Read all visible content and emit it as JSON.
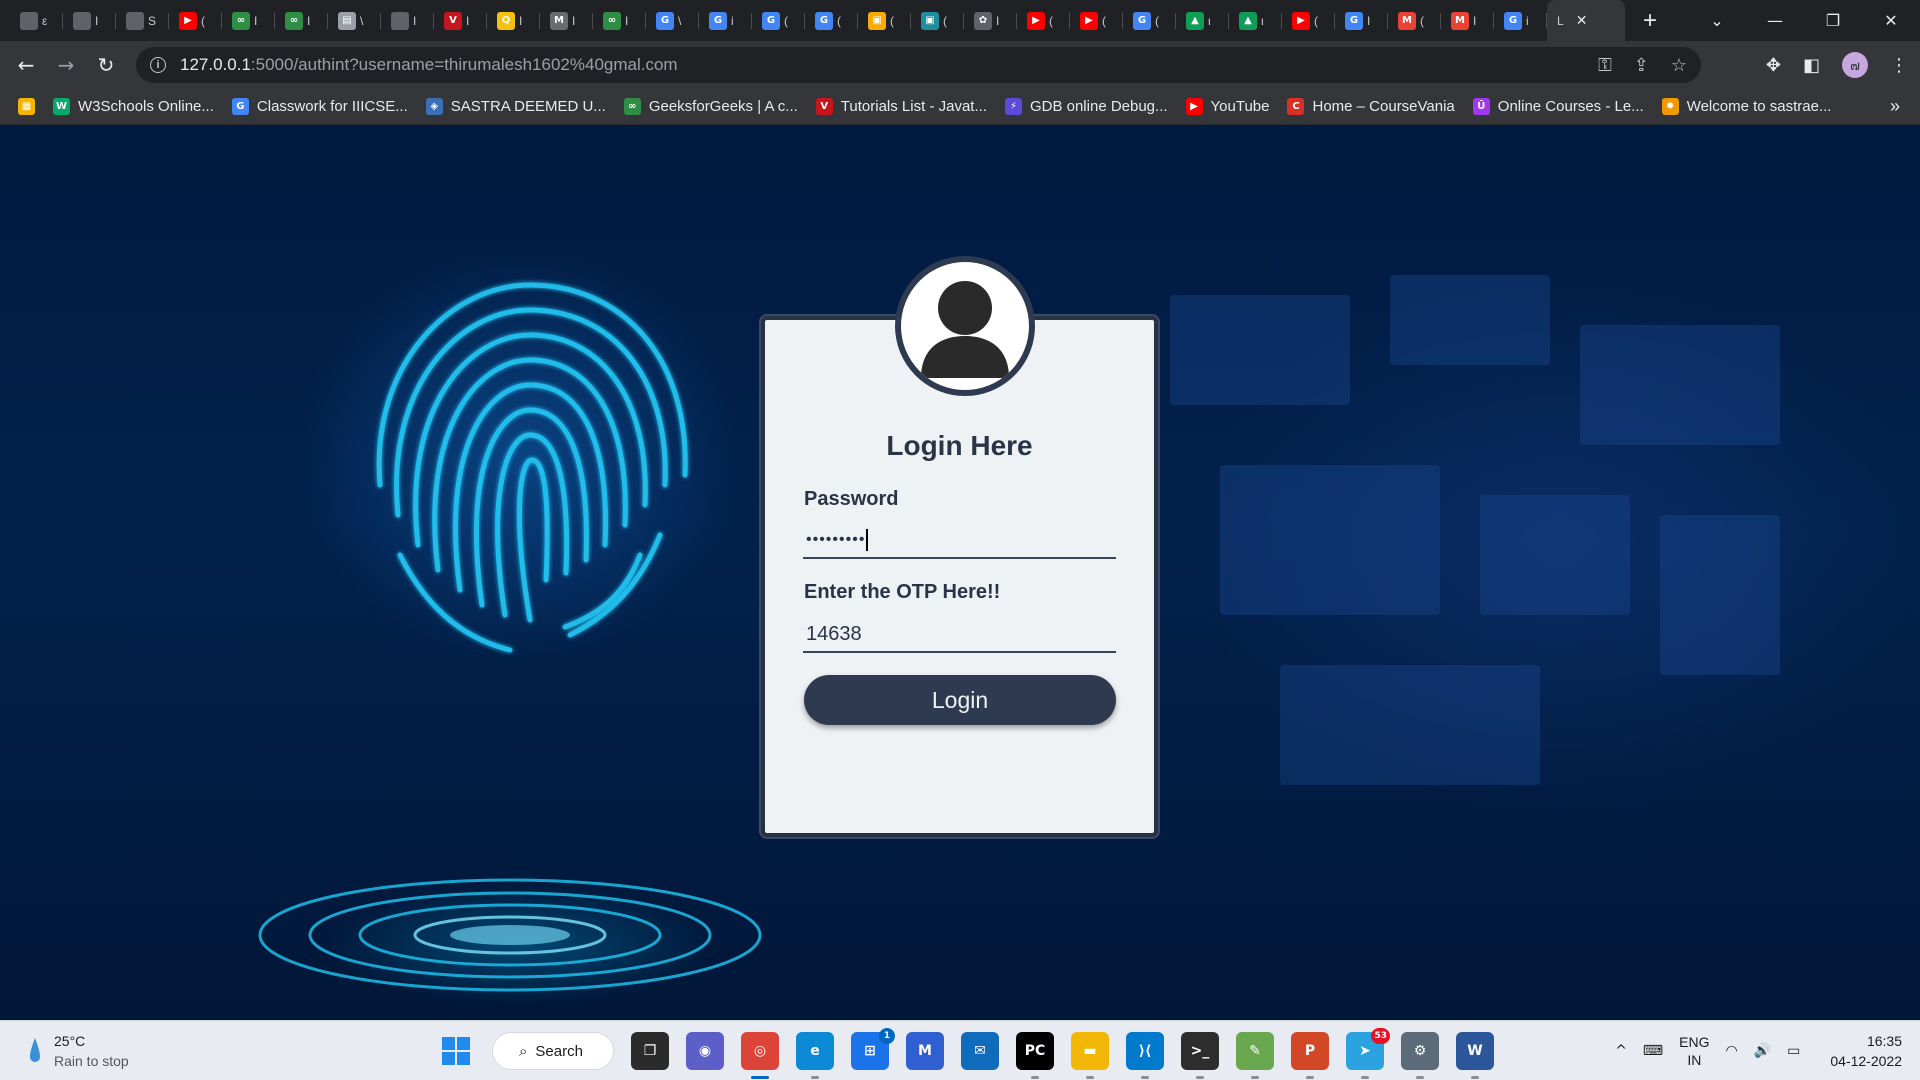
{
  "browser": {
    "tabs": [
      {
        "icon": "globe-icon",
        "letter": "",
        "title": "ε",
        "color": "#5f6368"
      },
      {
        "icon": "globe-icon",
        "letter": "",
        "title": "I",
        "color": "#5f6368"
      },
      {
        "icon": "globe-icon",
        "letter": "",
        "title": "S",
        "color": "#5f6368"
      },
      {
        "icon": "youtube-icon",
        "letter": "▶",
        "title": "(",
        "color": "#ff0000"
      },
      {
        "icon": "geeksforgeeks-icon",
        "letter": "∞",
        "title": "I",
        "color": "#2f8d46"
      },
      {
        "icon": "geeksforgeeks-icon",
        "letter": "∞",
        "title": "I",
        "color": "#2f8d46"
      },
      {
        "icon": "document-icon",
        "letter": "▤",
        "title": "\\",
        "color": "#9aa0a6"
      },
      {
        "icon": "globe-icon",
        "letter": "",
        "title": "I",
        "color": "#5f6368"
      },
      {
        "icon": "tutorialspoint-icon",
        "letter": "V",
        "title": "I",
        "color": "#c4161c"
      },
      {
        "icon": "stackedit-icon",
        "letter": "Q",
        "title": "I",
        "color": "#f4c20d"
      },
      {
        "icon": "medium-icon",
        "letter": "M",
        "title": "I",
        "color": "#6b6b6b"
      },
      {
        "icon": "geeksforgeeks-icon",
        "letter": "∞",
        "title": "I",
        "color": "#2f8d46"
      },
      {
        "icon": "google-icon",
        "letter": "G",
        "title": "\\",
        "color": "#4285f4"
      },
      {
        "icon": "google-icon",
        "letter": "G",
        "title": "i",
        "color": "#4285f4"
      },
      {
        "icon": "google-icon",
        "letter": "G",
        "title": "(",
        "color": "#4285f4"
      },
      {
        "icon": "google-icon",
        "letter": "G",
        "title": "(",
        "color": "#4285f4"
      },
      {
        "icon": "classroom-icon",
        "letter": "▣",
        "title": "(",
        "color": "#f9ab00"
      },
      {
        "icon": "classroom-icon",
        "letter": "▣",
        "title": "(",
        "color": "#1e8e9e"
      },
      {
        "icon": "openai-icon",
        "letter": "✿",
        "title": "I",
        "color": "#5f6368"
      },
      {
        "icon": "youtube-icon",
        "letter": "▶",
        "title": "(",
        "color": "#ff0000"
      },
      {
        "icon": "youtube-icon",
        "letter": "▶",
        "title": "(",
        "color": "#ff0000"
      },
      {
        "icon": "google-icon",
        "letter": "G",
        "title": "(",
        "color": "#4285f4"
      },
      {
        "icon": "drive-icon",
        "letter": "▲",
        "title": "ι",
        "color": "#0f9d58"
      },
      {
        "icon": "drive-icon",
        "letter": "▲",
        "title": "ι",
        "color": "#0f9d58"
      },
      {
        "icon": "youtube-icon",
        "letter": "▶",
        "title": "(",
        "color": "#ff0000"
      },
      {
        "icon": "google-icon",
        "letter": "G",
        "title": "I",
        "color": "#4285f4"
      },
      {
        "icon": "gmail-icon",
        "letter": "M",
        "title": "(",
        "color": "#ea4335"
      },
      {
        "icon": "gmail-icon",
        "letter": "M",
        "title": "I",
        "color": "#ea4335"
      },
      {
        "icon": "google-icon",
        "letter": "G",
        "title": "i",
        "color": "#4285f4"
      }
    ],
    "active_tab": {
      "title": "L",
      "close": "✕"
    },
    "new_tab": "+",
    "window_controls": {
      "dropdown": "⌄",
      "minimize": "—",
      "restore": "❐",
      "close": "✕"
    },
    "nav": {
      "back": "←",
      "forward": "→",
      "reload": "↻"
    },
    "url": {
      "host": "127.0.0.1",
      "rest": ":5000/authint?username=thirumalesh1602%40gmal.com"
    },
    "omnibox_icons": {
      "key": "⚿",
      "share": "⇪",
      "star": "☆"
    },
    "toolbar_icons": {
      "extensions": "✥",
      "sidepanel": "◧",
      "menu": "⋮",
      "profile": "๗"
    },
    "bookmarks": [
      {
        "icon": "apps-icon",
        "letter": "▦",
        "color": "#f4b400",
        "label": ""
      },
      {
        "icon": "w3schools-icon",
        "letter": "W",
        "color": "#04aa6d",
        "label": "W3Schools Online..."
      },
      {
        "icon": "google-icon",
        "letter": "G",
        "color": "#4285f4",
        "label": "Classwork for IIICSE..."
      },
      {
        "icon": "sastra-icon",
        "letter": "◈",
        "color": "#3b6fb6",
        "label": "SASTRA DEEMED U..."
      },
      {
        "icon": "geeksforgeeks-icon",
        "letter": "∞",
        "color": "#2f8d46",
        "label": "GeeksforGeeks | A c..."
      },
      {
        "icon": "tutorialspoint-icon",
        "letter": "V",
        "color": "#c4161c",
        "label": "Tutorials List - Javat..."
      },
      {
        "icon": "gdb-icon",
        "letter": "⚡",
        "color": "#5b4bd6",
        "label": "GDB online Debug..."
      },
      {
        "icon": "youtube-icon",
        "letter": "▶",
        "color": "#ff0000",
        "label": "YouTube"
      },
      {
        "icon": "coursevania-icon",
        "letter": "C",
        "color": "#d93025",
        "label": "Home – CourseVania"
      },
      {
        "icon": "udemy-icon",
        "letter": "Ū",
        "color": "#a435f0",
        "label": "Online Courses - Le..."
      },
      {
        "icon": "sastra-sun-icon",
        "letter": "✹",
        "color": "#f29900",
        "label": "Welcome to sastrae..."
      }
    ],
    "bookmarks_more": "»"
  },
  "login": {
    "title": "Login Here",
    "password_label": "Password",
    "password_value": "•••••••••",
    "otp_label": "Enter the OTP Here!!",
    "otp_value": "14638",
    "button_label": "Login"
  },
  "taskbar": {
    "weather": {
      "temp": "25°C",
      "condition": "Rain to stop"
    },
    "search_label": "Search",
    "apps": [
      {
        "name": "task-view-icon",
        "letter": "❐",
        "color": "#2b2b2b",
        "dot": false,
        "badge": ""
      },
      {
        "name": "teams-chat-icon",
        "letter": "◉",
        "color": "#5b5fc7",
        "dot": false,
        "badge": ""
      },
      {
        "name": "chrome-icon",
        "letter": "◎",
        "color": "#db4437",
        "dot": "active",
        "badge": ""
      },
      {
        "name": "edge-icon",
        "letter": "e",
        "color": "#0c8ad6",
        "dot": true,
        "badge": ""
      },
      {
        "name": "store-icon",
        "letter": "⊞",
        "color": "#1a73e8",
        "dot": false,
        "badge": "1"
      },
      {
        "name": "sticky-app-icon",
        "letter": "M",
        "color": "#2f5fd0",
        "dot": false,
        "badge": ""
      },
      {
        "name": "mail-icon",
        "letter": "✉",
        "color": "#0f6cbd",
        "dot": false,
        "badge": ""
      },
      {
        "name": "pycharm-icon",
        "letter": "PC",
        "color": "#000000",
        "dot": true,
        "badge": ""
      },
      {
        "name": "file-explorer-icon",
        "letter": "▬",
        "color": "#f2b705",
        "dot": true,
        "badge": ""
      },
      {
        "name": "vscode-icon",
        "letter": "⟩⟨",
        "color": "#007acc",
        "dot": true,
        "badge": ""
      },
      {
        "name": "terminal-icon",
        "letter": ">_",
        "color": "#2d2d2d",
        "dot": true,
        "badge": ""
      },
      {
        "name": "paint-icon",
        "letter": "✎",
        "color": "#6aa84f",
        "dot": true,
        "badge": ""
      },
      {
        "name": "powerpoint-icon",
        "letter": "P",
        "color": "#d24726",
        "dot": true,
        "badge": ""
      },
      {
        "name": "telegram-icon",
        "letter": "➤",
        "color": "#2aa3e0",
        "dot": true,
        "badge": "53"
      },
      {
        "name": "settings-icon",
        "letter": "⚙",
        "color": "#5c6b7a",
        "dot": true,
        "badge": ""
      },
      {
        "name": "word-icon",
        "letter": "W",
        "color": "#2b579a",
        "dot": true,
        "badge": ""
      }
    ],
    "tray": {
      "chevron": "^",
      "keyboard": "⌨",
      "lang_top": "ENG",
      "lang_bottom": "IN",
      "wifi": "◠",
      "volume": "🔊",
      "battery": "▭",
      "time": "16:35",
      "date": "04-12-2022"
    }
  }
}
